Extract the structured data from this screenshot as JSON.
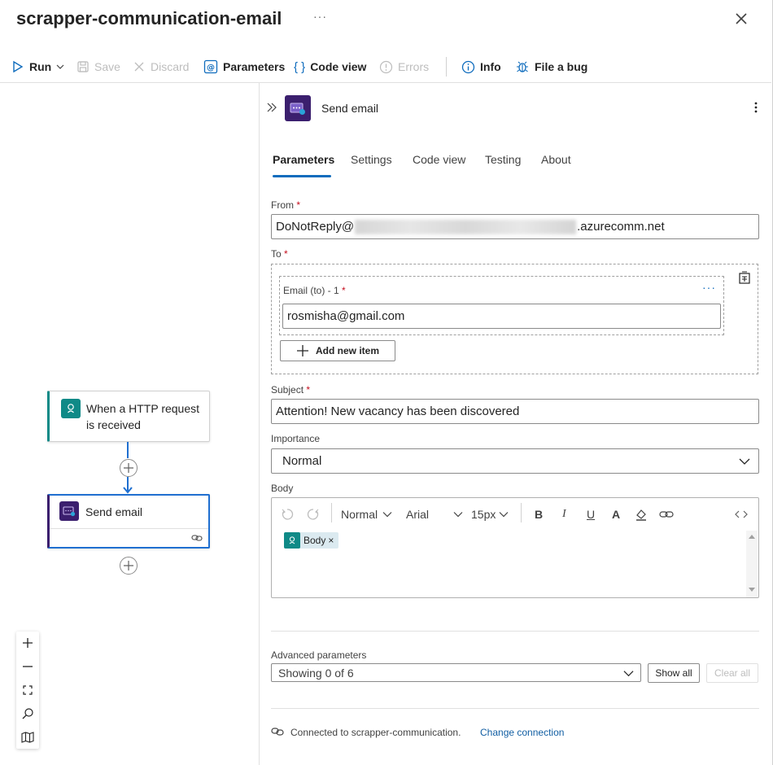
{
  "header": {
    "title": "scrapper-communication-email",
    "more": "···"
  },
  "toolbar": {
    "run": "Run",
    "save": "Save",
    "discard": "Discard",
    "parameters": "Parameters",
    "code_view": "Code view",
    "errors": "Errors",
    "info": "Info",
    "file_bug": "File a bug"
  },
  "canvas": {
    "trigger_label_1": "When a HTTP request",
    "trigger_label_2": "is received",
    "action_label": "Send email"
  },
  "panel": {
    "title": "Send email",
    "tabs": [
      "Parameters",
      "Settings",
      "Code view",
      "Testing",
      "About"
    ],
    "from": {
      "label": "From",
      "prefix": "DoNotReply@",
      "suffix": ".azurecomm.net"
    },
    "to": {
      "label": "To",
      "item_label": "Email (to) - 1",
      "item_value": "rosmisha@gmail.com",
      "item_more": "···",
      "add_item": "Add new item"
    },
    "subject": {
      "label": "Subject",
      "value": "Attention! New vacancy has been discovered"
    },
    "importance": {
      "label": "Importance",
      "value": "Normal"
    },
    "body": {
      "label": "Body",
      "format": "Normal",
      "font": "Arial",
      "size": "15px",
      "token": "Body",
      "token_close": "×"
    },
    "advanced": {
      "label": "Advanced parameters",
      "value": "Showing 0 of 6",
      "show_all": "Show all",
      "clear_all": "Clear all"
    },
    "connection": {
      "text": "Connected to scrapper-communication.",
      "change": "Change connection"
    },
    "required_mark": "*"
  },
  "colors": {
    "accent": "#0f6cbd",
    "trigger": "#0f8a87",
    "email_icon": "#3b1f6e"
  }
}
